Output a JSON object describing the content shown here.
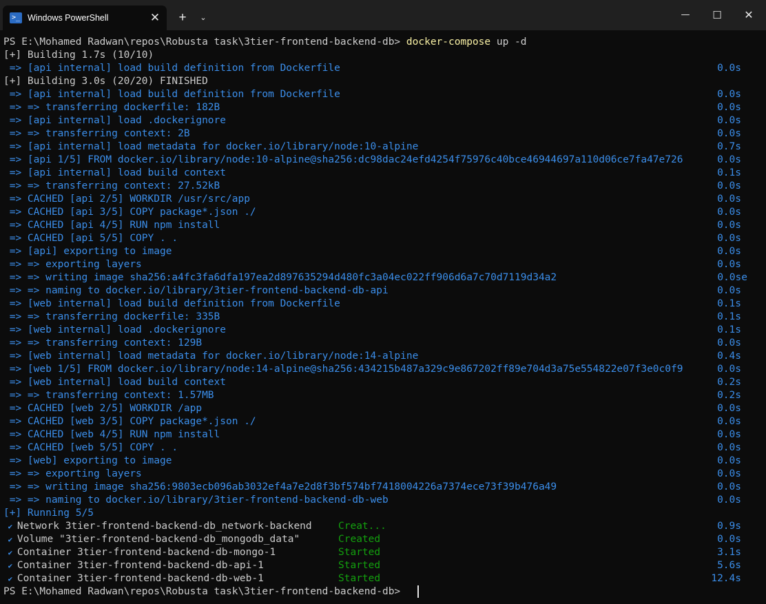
{
  "tab": {
    "title": "Windows PowerShell",
    "icon": "powershell-icon",
    "close": "✕"
  },
  "controls": {
    "new_tab": "+",
    "dropdown": "⌄",
    "minimize": "—",
    "maximize": "☐",
    "close": "✕"
  },
  "terminal": {
    "prompt": "PS E:\\Mohamed Radwan\\repos\\Robusta task\\3tier-frontend-backend-db> ",
    "command": "docker-compose",
    "args": " up -d",
    "lines": [
      {
        "text": "[+] Building 1.7s (10/10)",
        "time": ""
      },
      {
        "text": " => [api internal] load build definition from Dockerfile",
        "time": "0.0s"
      },
      {
        "text": "[+] Building 3.0s (20/20) FINISHED",
        "time": ""
      },
      {
        "text": " => [api internal] load build definition from Dockerfile",
        "time": "0.0s"
      },
      {
        "text": " => => transferring dockerfile: 182B",
        "time": "0.0s"
      },
      {
        "text": " => [api internal] load .dockerignore",
        "time": "0.0s"
      },
      {
        "text": " => => transferring context: 2B",
        "time": "0.0s"
      },
      {
        "text": " => [api internal] load metadata for docker.io/library/node:10-alpine",
        "time": "0.7s"
      },
      {
        "text": " => [api 1/5] FROM docker.io/library/node:10-alpine@sha256:dc98dac24efd4254f75976c40bce46944697a110d06ce7fa47e726",
        "time": "0.0s"
      },
      {
        "text": " => [api internal] load build context",
        "time": "0.1s"
      },
      {
        "text": " => => transferring context: 27.52kB",
        "time": "0.0s"
      },
      {
        "text": " => CACHED [api 2/5] WORKDIR /usr/src/app",
        "time": "0.0s"
      },
      {
        "text": " => CACHED [api 3/5] COPY package*.json ./",
        "time": "0.0s"
      },
      {
        "text": " => CACHED [api 4/5] RUN npm install",
        "time": "0.0s"
      },
      {
        "text": " => CACHED [api 5/5] COPY . .",
        "time": "0.0s"
      },
      {
        "text": " => [api] exporting to image",
        "time": "0.0s"
      },
      {
        "text": " => => exporting layers",
        "time": "0.0s"
      },
      {
        "text": " => => writing image sha256:a4fc3fa6dfa197ea2d897635294d480fc3a04ec022ff906d6a7c70d7119d34a2",
        "time": "0.0se"
      },
      {
        "text": " => => naming to docker.io/library/3tier-frontend-backend-db-api",
        "time": "0.0s"
      },
      {
        "text": " => [web internal] load build definition from Dockerfile",
        "time": "0.1s"
      },
      {
        "text": " => => transferring dockerfile: 335B",
        "time": "0.1s"
      },
      {
        "text": " => [web internal] load .dockerignore",
        "time": "0.1s"
      },
      {
        "text": " => => transferring context: 129B",
        "time": "0.0s"
      },
      {
        "text": " => [web internal] load metadata for docker.io/library/node:14-alpine",
        "time": "0.4s"
      },
      {
        "text": " => [web 1/5] FROM docker.io/library/node:14-alpine@sha256:434215b487a329c9e867202ff89e704d3a75e554822e07f3e0c0f9",
        "time": "0.0s"
      },
      {
        "text": " => [web internal] load build context",
        "time": "0.2s"
      },
      {
        "text": " => => transferring context: 1.57MB",
        "time": "0.2s"
      },
      {
        "text": " => CACHED [web 2/5] WORKDIR /app",
        "time": "0.0s"
      },
      {
        "text": " => CACHED [web 3/5] COPY package*.json ./",
        "time": "0.0s"
      },
      {
        "text": " => CACHED [web 4/5] RUN npm install",
        "time": "0.0s"
      },
      {
        "text": " => CACHED [web 5/5] COPY . .",
        "time": "0.0s"
      },
      {
        "text": " => [web] exporting to image",
        "time": "0.0s"
      },
      {
        "text": " => => exporting layers",
        "time": "0.0s"
      },
      {
        "text": " => => writing image sha256:9803ecb096ab3032ef4a7e2d8f3bf574bf7418004226a7374ece73f39b476a49",
        "time": "0.0s"
      },
      {
        "text": " => => naming to docker.io/library/3tier-frontend-backend-db-web",
        "time": "0.0s"
      }
    ],
    "running": "[+] Running 5/5",
    "services": [
      {
        "check": "✔",
        "kind": "Network",
        "name": "3tier-frontend-backend-db_network-backend",
        "status": "Creat...",
        "time": "0.9s"
      },
      {
        "check": "✔",
        "kind": "Volume",
        "name": "\"3tier-frontend-backend-db_mongodb_data\"",
        "status": "Created",
        "time": "0.0s"
      },
      {
        "check": "✔",
        "kind": "Container",
        "name": "3tier-frontend-backend-db-mongo-1",
        "status": "Started",
        "time": "3.1s"
      },
      {
        "check": "✔",
        "kind": "Container",
        "name": "3tier-frontend-backend-db-api-1",
        "status": "Started",
        "time": "5.6s"
      },
      {
        "check": "✔",
        "kind": "Container",
        "name": "3tier-frontend-backend-db-web-1",
        "status": "Started",
        "time": "12.4s"
      }
    ],
    "final_prompt": "PS E:\\Mohamed Radwan\\repos\\Robusta task\\3tier-frontend-backend-db> "
  }
}
